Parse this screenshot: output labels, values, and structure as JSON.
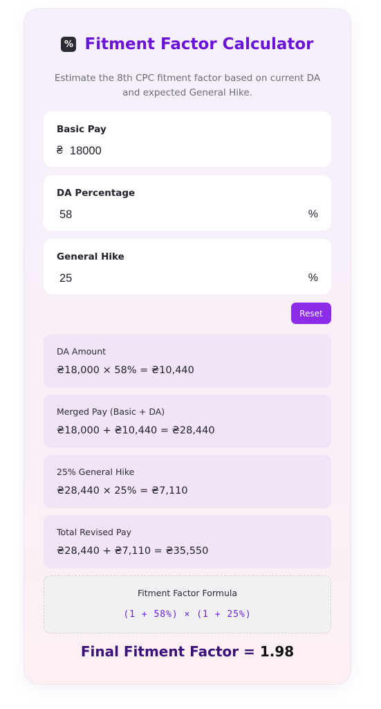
{
  "header": {
    "icon": "percent-icon",
    "icon_glyph": "%",
    "title": "Fitment Factor Calculator",
    "subtitle": "Estimate the 8th CPC fitment factor based on current DA and expected General Hike."
  },
  "inputs": {
    "basic_pay": {
      "label": "Basic Pay",
      "prefix": "₴",
      "value": "18000"
    },
    "da_percentage": {
      "label": "DA Percentage",
      "value": "58",
      "suffix": "%"
    },
    "general_hike": {
      "label": "General Hike",
      "value": "25",
      "suffix": "%"
    }
  },
  "reset_label": "Reset",
  "results": [
    {
      "label": "DA Amount",
      "value": "₴18,000 × 58% = ₴10,440"
    },
    {
      "label": "Merged Pay (Basic + DA)",
      "value": "₴18,000 + ₴10,440 = ₴28,440"
    },
    {
      "label": "25% General Hike",
      "value": "₴28,440 × 25% = ₴7,110"
    },
    {
      "label": "Total Revised Pay",
      "value": "₴28,440 + ₴7,110 = ₴35,550"
    }
  ],
  "formula": {
    "label": "Fitment Factor Formula",
    "value": "(1 + 58%) × (1 + 25%)"
  },
  "final": {
    "label": "Final Fitment Factor = ",
    "value": "1.98"
  },
  "colors": {
    "accent": "#8c2be8",
    "title": "#6a12d8",
    "result_bg": "#f1e4f6"
  }
}
